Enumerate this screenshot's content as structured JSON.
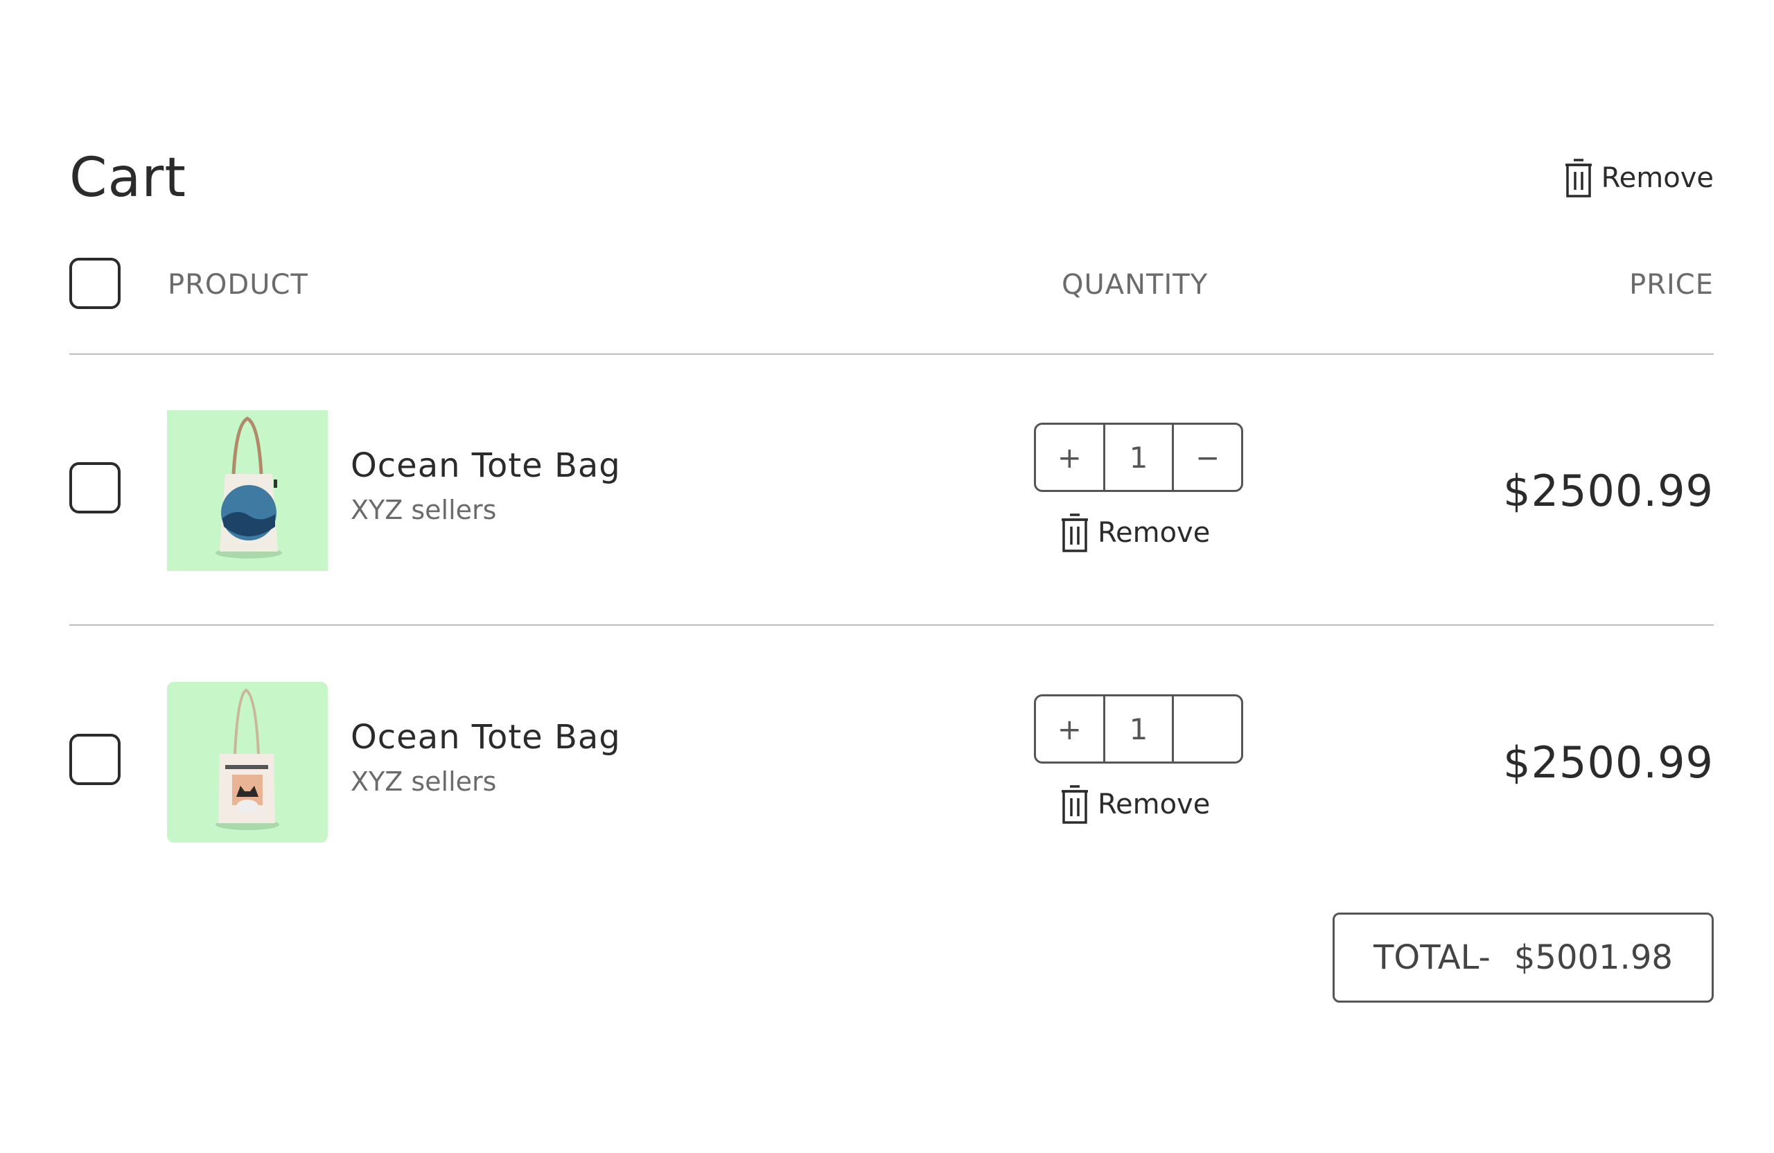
{
  "page": {
    "title": "Cart",
    "remove_all_label": "Remove"
  },
  "table": {
    "headers": {
      "product": "PRODUCT",
      "quantity": "QUANTITY",
      "price": "PRICE"
    }
  },
  "items": [
    {
      "name": "Ocean Tote Bag",
      "seller": "XYZ sellers",
      "quantity": "1",
      "increment_label": "+",
      "decrement_label": "−",
      "remove_label": "Remove",
      "price": "$2500.99",
      "image_icon": "tote-bag-ocean-print"
    },
    {
      "name": "Ocean Tote Bag",
      "seller": "XYZ sellers",
      "quantity": "1",
      "increment_label": "+",
      "decrement_label": "",
      "remove_label": "Remove",
      "price": "$2500.99",
      "image_icon": "tote-bag-cat-print"
    }
  ],
  "summary": {
    "total_label": "TOTAL-",
    "total_value": "$5001.98"
  },
  "colors": {
    "thumb_background": "#c7f7c9",
    "text_primary": "#2b2b2b",
    "text_secondary": "#6b6b6b",
    "divider": "#bdbdbd"
  }
}
